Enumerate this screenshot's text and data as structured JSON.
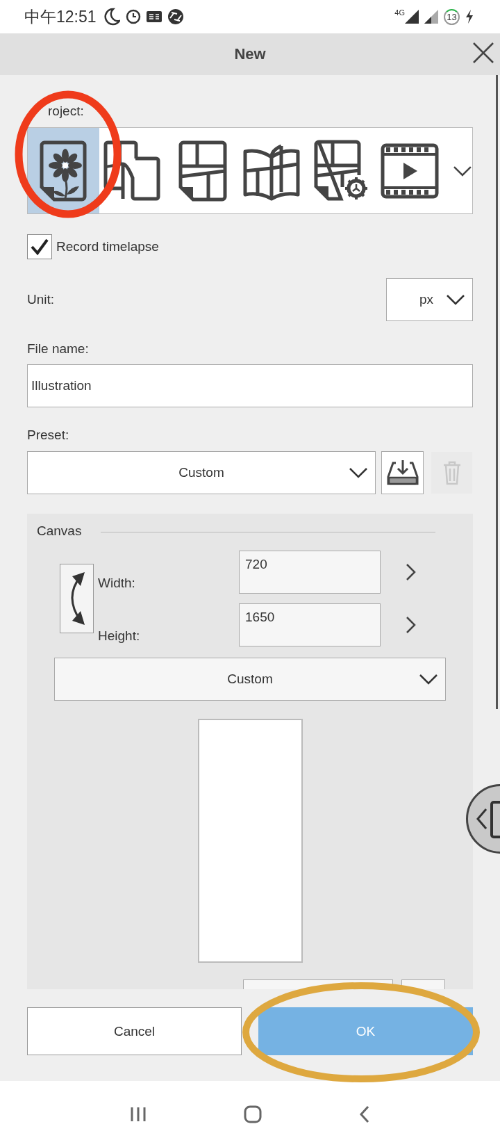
{
  "status_bar": {
    "time": "中午12:51",
    "network": "4G",
    "battery": "13"
  },
  "dialog": {
    "title": "New"
  },
  "project": {
    "label": "roject:",
    "types": [
      {
        "kind": "illustration",
        "selected": true
      },
      {
        "kind": "comic",
        "selected": false
      },
      {
        "kind": "pages",
        "selected": false
      },
      {
        "kind": "book",
        "selected": false
      },
      {
        "kind": "page-settings",
        "selected": false
      },
      {
        "kind": "animation",
        "selected": false
      }
    ]
  },
  "record_timelapse": {
    "label": "Record timelapse",
    "checked": true
  },
  "unit": {
    "label": "Unit:",
    "value": "px"
  },
  "file_name": {
    "label": "File name:",
    "value": "Illustration"
  },
  "preset": {
    "label": "Preset:",
    "value": "Custom",
    "delete_disabled": true
  },
  "canvas": {
    "title": "Canvas",
    "width": {
      "label": "Width:",
      "value": "720"
    },
    "height": {
      "label": "Height:",
      "value": "1650"
    },
    "size_preset": "Custom"
  },
  "buttons": {
    "cancel": "Cancel",
    "ok": "OK"
  },
  "annotations": [
    {
      "color": "#ef3b1b"
    },
    {
      "color": "#dea83f"
    }
  ]
}
